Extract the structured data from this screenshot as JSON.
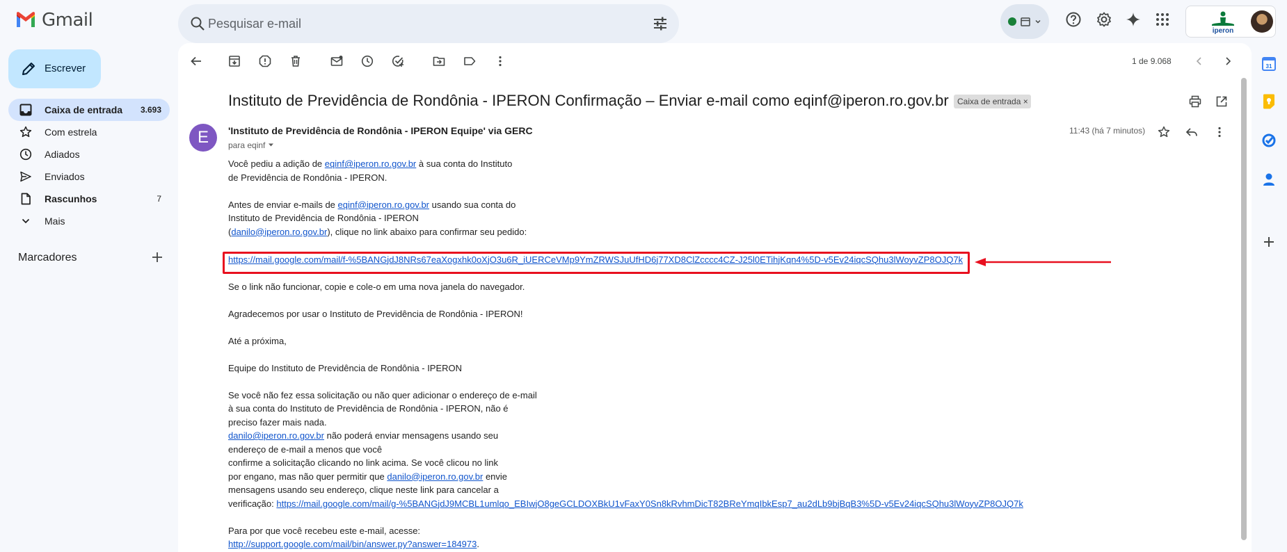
{
  "app": {
    "name": "Gmail"
  },
  "search": {
    "placeholder": "Pesquisar e-mail"
  },
  "compose": {
    "label": "Escrever"
  },
  "nav": {
    "items": [
      {
        "label": "Caixa de entrada",
        "count": "3.693"
      },
      {
        "label": "Com estrela",
        "count": ""
      },
      {
        "label": "Adiados",
        "count": ""
      },
      {
        "label": "Enviados",
        "count": ""
      },
      {
        "label": "Rascunhos",
        "count": "7"
      },
      {
        "label": "Mais",
        "count": ""
      }
    ],
    "labels_title": "Marcadores"
  },
  "org": {
    "logo_text": "iperon"
  },
  "toolbar": {
    "pager": "1 de 9.068"
  },
  "email": {
    "subject": "Instituto de Previdência de Rondônia - IPERON Confirmação – Enviar e-mail como eqinf@iperon.ro.gov.br",
    "label_chip": "Caixa de entrada",
    "avatar_letter": "E",
    "sender": "'Instituto de Previdência de Rondônia - IPERON Equipe' via GERC",
    "recipient": "para eqinf",
    "time": "11:43 (há 7 minutos)",
    "body": {
      "p1_a": "Você pediu a adição de ",
      "p1_link": "eqinf@iperon.ro.gov.br",
      "p1_b": " à sua conta do Instituto",
      "p1_c": "de Previdência de Rondônia - IPERON.",
      "p2_a": "Antes de enviar e-mails de ",
      "p2_link": "eqinf@iperon.ro.gov.br",
      "p2_b": " usando sua conta do",
      "p2_c": "Instituto de Previdência de Rondônia - IPERON",
      "p2_d": "(",
      "p2_link2": "danilo@iperon.ro.gov.br",
      "p2_e": "), clique no link abaixo para confirmar seu pedido:",
      "confirm_link": "https://mail.google.com/mail/f-%5BANGjdJ8NRs67eaXogxhk0oXjO3u6R_iUERCeVMp9YmZRWSJuUfHD6j77XD8ClZcccc4CZ-J25l0ETihjKqn4%5D-v5Ev24iqcSQhu3lWoyvZP8OJQ7k",
      "p3": "Se o link não funcionar, copie e cole-o em uma nova janela do navegador.",
      "p4": "Agradecemos por usar o Instituto de Previdência de Rondônia - IPERON!",
      "p5": "Até a próxima,",
      "p6": "Equipe do Instituto de Previdência de Rondônia - IPERON",
      "p7_l1": "Se você não fez essa solicitação ou não quer adicionar o endereço de e-mail",
      "p7_l2": "à sua conta do Instituto de Previdência de Rondônia - IPERON, não é",
      "p7_l3": "preciso fazer mais nada.",
      "p7_link1": "danilo@iperon.ro.gov.br",
      "p7_l4": " não poderá enviar mensagens usando seu",
      "p7_l5": "endereço de e-mail a menos que você",
      "p7_l6": "confirme a solicitação clicando no link acima. Se você clicou no link",
      "p7_l7": "por engano, mas não quer permitir que ",
      "p7_link2": "danilo@iperon.ro.gov.br",
      "p7_l8": " envie",
      "p7_l9": "mensagens usando seu endereço, clique neste link para cancelar a",
      "p7_l10": "verificação: ",
      "cancel_link": "https://mail.google.com/mail/g-%5BANGjdJ9MCBL1umlqo_EBIwjO8geGCLDOXBkU1vFaxY0Sn8kRvhmDicT82BReYmqIbkEsp7_au2dLb9bjBqB3%5D-v5Ev24iqcSQhu3lWoyvZP8OJQ7k",
      "p8": "Para por que você recebeu este e-mail, acesse:",
      "help_link": "http://support.google.com/mail/bin/answer.py?answer=184973",
      "help_tail": "."
    }
  },
  "colors": {
    "highlight": "#e8101f",
    "link": "#1155cc",
    "compose_bg": "#c2e7ff",
    "active_nav": "#d3e3fd",
    "avatar": "#7e57c2"
  }
}
